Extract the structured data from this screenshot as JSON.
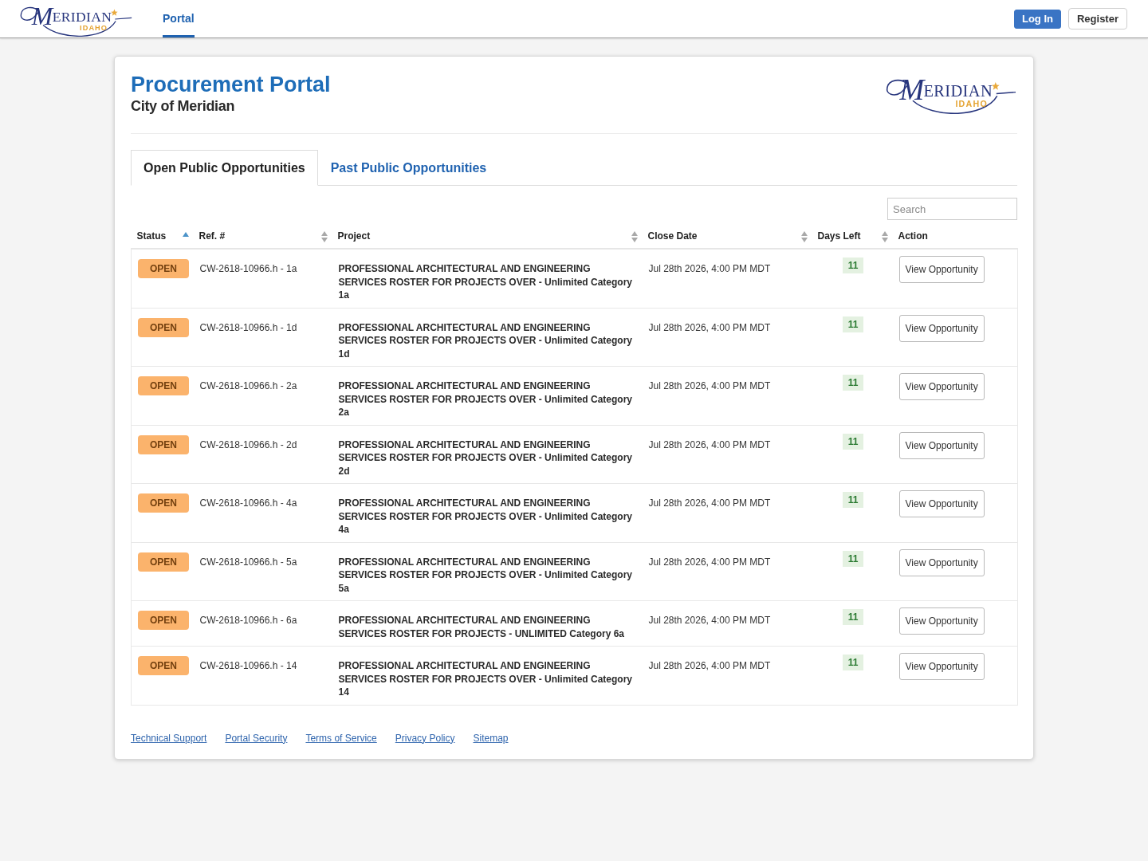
{
  "header": {
    "logo": {
      "name": "MERIDIAN",
      "region": "IDAHO"
    },
    "nav": [
      {
        "label": "Portal",
        "selected": true
      }
    ],
    "buttons": [
      {
        "label": "Log In",
        "kind": "primary"
      },
      {
        "label": "Register",
        "kind": "secondary"
      }
    ]
  },
  "portal": {
    "title": "Procurement Portal",
    "subtitle": "City of Meridian",
    "logo": {
      "name": "MERIDIAN",
      "region": "IDAHO"
    }
  },
  "tabs": [
    {
      "label": "Open Public Opportunities",
      "selected": true
    },
    {
      "label": "Past Public Opportunities",
      "selected": false
    }
  ],
  "search": {
    "placeholder": "Search"
  },
  "table": {
    "columns": [
      {
        "label": "Status",
        "sortable": true,
        "sorted": true
      },
      {
        "label": "Ref. #",
        "sortable": true,
        "sorted": false
      },
      {
        "label": "Project",
        "sortable": true,
        "sorted": false
      },
      {
        "label": "Close Date",
        "sortable": true,
        "sorted": false
      },
      {
        "label": "Days Left",
        "sortable": true,
        "sorted": false
      },
      {
        "label": "Action",
        "sortable": false,
        "sorted": false
      }
    ],
    "rows": [
      {
        "status": "OPEN",
        "ref": "CW-2618-10966.h - 1a",
        "project": "PROFESSIONAL ARCHITECTURAL AND ENGINEERING SERVICES ROSTER FOR PROJECTS OVER - Unlimited Category 1a",
        "close_date": "Jul 28th 2026, 4:00 PM MDT",
        "days_left": "11",
        "action": "View Opportunity"
      },
      {
        "status": "OPEN",
        "ref": "CW-2618-10966.h - 1d",
        "project": "PROFESSIONAL ARCHITECTURAL AND ENGINEERING SERVICES ROSTER FOR PROJECTS OVER - Unlimited Category 1d",
        "close_date": "Jul 28th 2026, 4:00 PM MDT",
        "days_left": "11",
        "action": "View Opportunity"
      },
      {
        "status": "OPEN",
        "ref": "CW-2618-10966.h - 2a",
        "project": "PROFESSIONAL ARCHITECTURAL AND ENGINEERING SERVICES ROSTER FOR PROJECTS OVER - Unlimited Category 2a",
        "close_date": "Jul 28th 2026, 4:00 PM MDT",
        "days_left": "11",
        "action": "View Opportunity"
      },
      {
        "status": "OPEN",
        "ref": "CW-2618-10966.h - 2d",
        "project": "PROFESSIONAL ARCHITECTURAL AND ENGINEERING SERVICES ROSTER FOR PROJECTS OVER - Unlimited Category 2d",
        "close_date": "Jul 28th 2026, 4:00 PM MDT",
        "days_left": "11",
        "action": "View Opportunity"
      },
      {
        "status": "OPEN",
        "ref": "CW-2618-10966.h - 4a",
        "project": "PROFESSIONAL ARCHITECTURAL AND ENGINEERING SERVICES ROSTER FOR PROJECTS OVER - Unlimited Category 4a",
        "close_date": "Jul 28th 2026, 4:00 PM MDT",
        "days_left": "11",
        "action": "View Opportunity"
      },
      {
        "status": "OPEN",
        "ref": "CW-2618-10966.h - 5a",
        "project": "PROFESSIONAL ARCHITECTURAL AND ENGINEERING SERVICES ROSTER FOR PROJECTS OVER - Unlimited Category 5a",
        "close_date": "Jul 28th 2026, 4:00 PM MDT",
        "days_left": "11",
        "action": "View Opportunity"
      },
      {
        "status": "OPEN",
        "ref": "CW-2618-10966.h - 6a",
        "project": "PROFESSIONAL ARCHITECTURAL AND ENGINEERING SERVICES ROSTER FOR PROJECTS - UNLIMITED Category 6a",
        "close_date": "Jul 28th 2026, 4:00 PM MDT",
        "days_left": "11",
        "action": "View Opportunity"
      },
      {
        "status": "OPEN",
        "ref": "CW-2618-10966.h - 14",
        "project": "PROFESSIONAL ARCHITECTURAL AND ENGINEERING SERVICES ROSTER FOR PROJECTS OVER - Unlimited Category 14",
        "close_date": "Jul 28th 2026, 4:00 PM MDT",
        "days_left": "11",
        "action": "View Opportunity"
      }
    ]
  },
  "footer": {
    "links": [
      "Technical Support",
      "Portal Security",
      "Terms of Service",
      "Privacy Policy",
      "Sitemap"
    ]
  }
}
